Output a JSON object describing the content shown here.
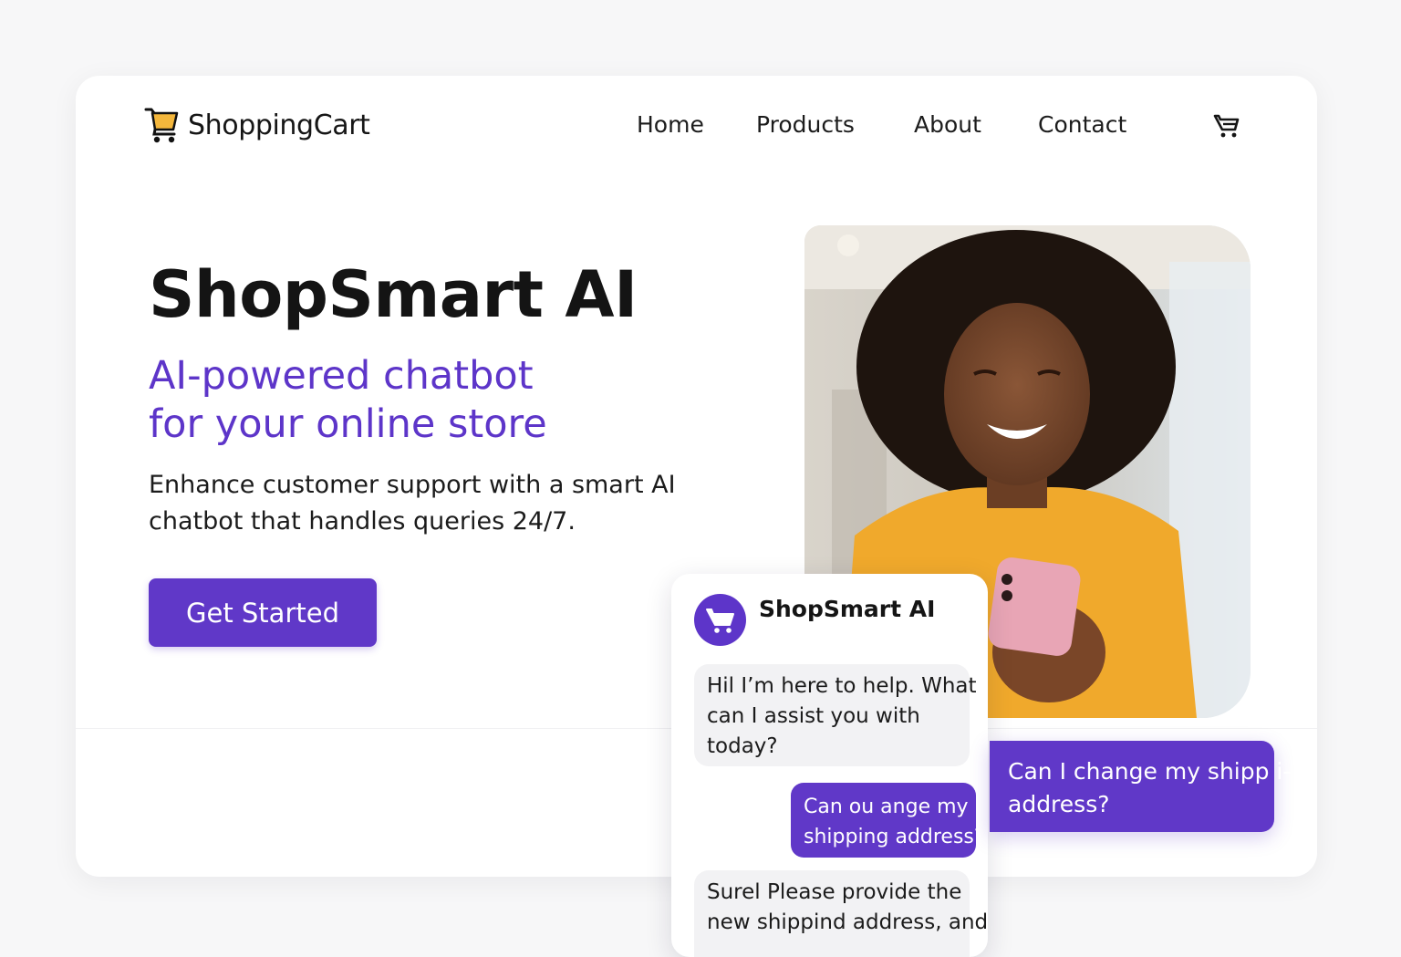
{
  "brand": {
    "name": "ShoppingCart",
    "logo_icon": "shopping-cart-icon",
    "logo_color": "#f4b73c"
  },
  "nav": {
    "items": [
      {
        "label": "Home"
      },
      {
        "label": "Products"
      },
      {
        "label": "About"
      },
      {
        "label": "Contact"
      }
    ],
    "cart_icon": "cart-icon"
  },
  "hero": {
    "title": "ShopSmart AI",
    "subtitle_lines": [
      "AI-powered chatbot",
      "for your online store"
    ],
    "description_lines": [
      "Enhance customer support with a smart AI",
      "chatbot that handles queries 24/7."
    ],
    "cta_label": "Get Started"
  },
  "chat": {
    "name": "ShopSmart AI",
    "avatar_icon": "cart-icon",
    "messages": [
      {
        "from": "bot",
        "lines": [
          "Hil I’m here to help. What",
          "can I assist you with",
          "today?"
        ]
      },
      {
        "from": "user",
        "lines": [
          "Can  ou ange my",
          "shipping address?"
        ]
      },
      {
        "from": "bot",
        "lines": [
          "Surel Please provide the",
          "new shippind address, and"
        ]
      }
    ]
  },
  "floating_message": {
    "lines": [
      "Can I change my shipp i-",
      "address?"
    ]
  },
  "colors": {
    "accent": "#5d35c9",
    "background": "#f7f7f8",
    "card": "#ffffff"
  }
}
